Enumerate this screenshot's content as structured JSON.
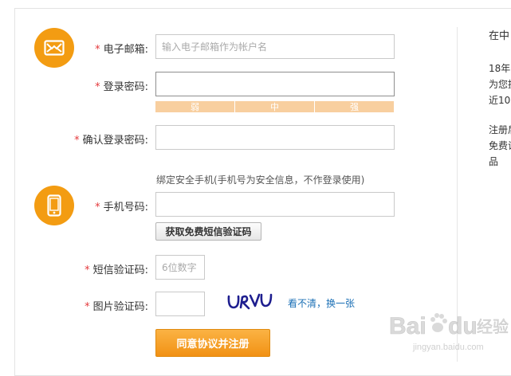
{
  "form": {
    "email": {
      "label": "电子邮箱:",
      "placeholder": "输入电子邮箱作为帐户名",
      "value": ""
    },
    "password": {
      "label": "登录密码:",
      "value": ""
    },
    "strength": {
      "weak": "弱",
      "medium": "中",
      "strong": "强"
    },
    "confirm_password": {
      "label": "确认登录密码:",
      "value": ""
    },
    "phone_hint": "绑定安全手机(手机号为安全信息，不作登录使用)",
    "phone": {
      "label": "手机号码:",
      "value": ""
    },
    "sms_button": "获取免费短信验证码",
    "sms_code": {
      "label": "短信验证码:",
      "placeholder": "6位数字",
      "value": ""
    },
    "image_code": {
      "label": "图片验证码:",
      "value": "",
      "captcha_text": "URVU",
      "refresh_link": "看不清，换一张"
    },
    "submit_button": "同意协议并注册",
    "required_mark": "*"
  },
  "side_panel": {
    "line1": "在中",
    "line2": "18年",
    "line3": "为您提",
    "line4": "近10",
    "line5": "注册后",
    "line6": "免费试",
    "line7": "品"
  },
  "watermark": {
    "brand": "Baidu",
    "suffix": "经验",
    "url": "jingyan.baidu.com"
  },
  "colors": {
    "accent": "#f39c12",
    "required": "#e4393c",
    "link": "#1a6fb5",
    "strength_bar": "#f8cf9f"
  },
  "icons": {
    "email_section": "envelope-icon",
    "phone_section": "mobile-phone-icon"
  }
}
